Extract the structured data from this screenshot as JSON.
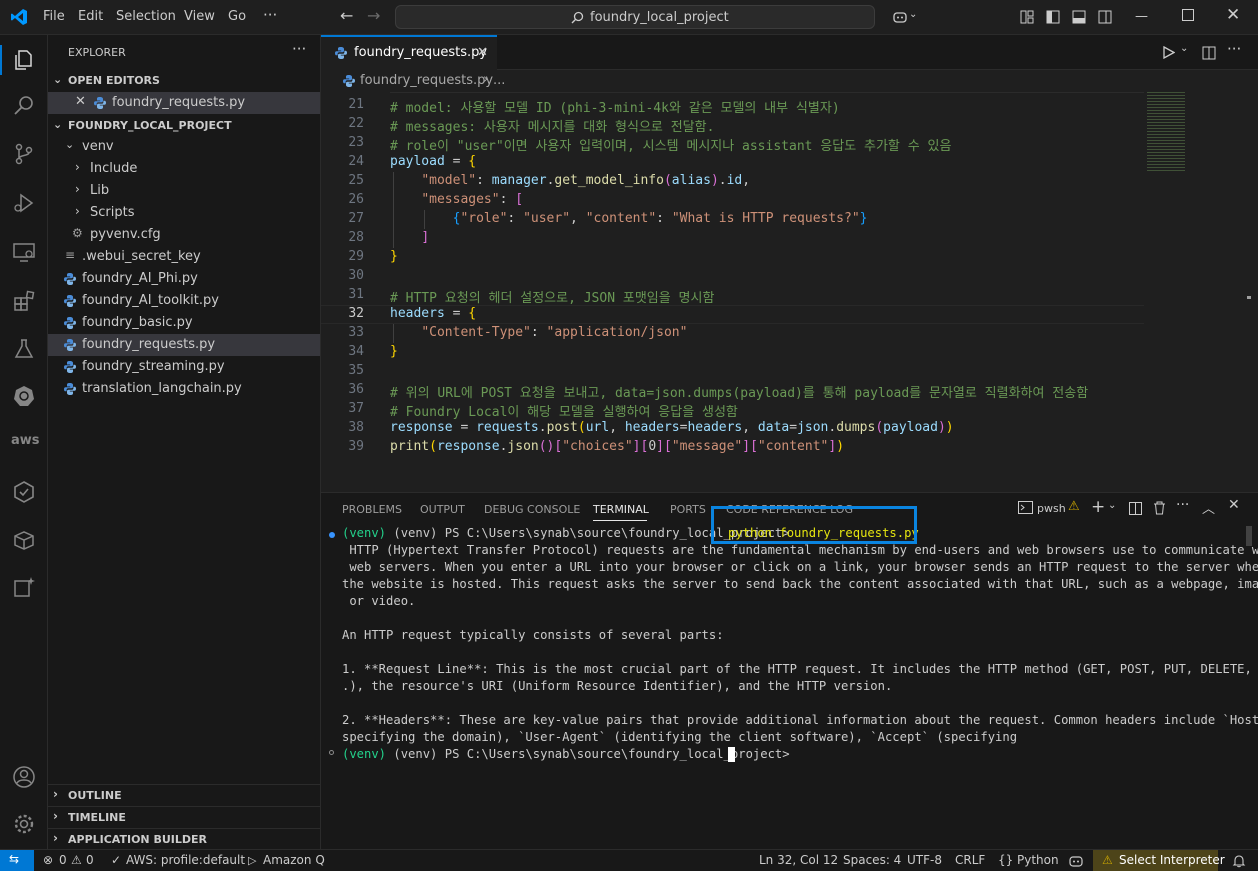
{
  "titlebar": {
    "menu": [
      "File",
      "Edit",
      "Selection",
      "View",
      "Go",
      "···"
    ],
    "search_text": "foundry_local_project"
  },
  "sidebar": {
    "title": "EXPLORER",
    "open_editors": {
      "label": "OPEN EDITORS",
      "items": [
        "foundry_requests.py"
      ]
    },
    "project": {
      "label": "FOUNDRY_LOCAL_PROJECT",
      "items": [
        "venv",
        "Include",
        "Lib",
        "Scripts",
        "pyvenv.cfg",
        ".webui_secret_key",
        "foundry_AI_Phi.py",
        "foundry_AI_toolkit.py",
        "foundry_basic.py",
        "foundry_requests.py",
        "foundry_streaming.py",
        "translation_langchain.py"
      ]
    },
    "bottom_sections": [
      "OUTLINE",
      "TIMELINE",
      "APPLICATION BUILDER"
    ]
  },
  "editor": {
    "tab_label": "foundry_requests.py",
    "breadcrumb_file": "foundry_requests.py",
    "breadcrumb_more": "...",
    "line_numbers": [
      "21",
      "22",
      "23",
      "24",
      "25",
      "26",
      "27",
      "28",
      "29",
      "30",
      "31",
      "32",
      "33",
      "34",
      "35",
      "36",
      "37",
      "38",
      "39"
    ],
    "current_line": "32",
    "lines": {
      "l21": "# model: 사용할 모델 ID (phi-3-mini-4k와 같은 모델의 내부 식별자)",
      "l22": "# messages: 사용자 메시지를 대화 형식으로 전달함.",
      "l23": "# role이 \"user\"이면 사용자 입력이며, 시스템 메시지나 assistant 응답도 추가할 수 있음",
      "l31": "# HTTP 요청의 헤더 설정으로, JSON 포맷임을 명시함",
      "l36": "# 위의 URL에 POST 요청을 보내고, data=json.dumps(payload)를 통해 payload를 문자열로 직렬화하여 전송함",
      "l37": "# Foundry Local이 해당 모델을 실행하여 응답을 생성함"
    }
  },
  "panel": {
    "tabs": [
      "PROBLEMS",
      "OUTPUT",
      "DEBUG CONSOLE",
      "TERMINAL",
      "PORTS",
      "CODE REFERENCE LOG"
    ],
    "active_tab": "TERMINAL",
    "shell_label": "pwsh",
    "prompt": "(venv) PS C:\\Users\\synab\\source\\foundry_local_project>",
    "command": "python foundry_requests.py",
    "output": [
      " HTTP (Hypertext Transfer Protocol) requests are the fundamental mechanism by end-users and web browsers use to communicate with",
      " web servers. When you enter a URL into your browser or click on a link, your browser sends an HTTP request to the server where",
      "the website is hosted. This request asks the server to send back the content associated with that URL, such as a webpage, image,",
      " or video.",
      "",
      "An HTTP request typically consists of several parts:",
      "",
      "1. **Request Line**: This is the most crucial part of the HTTP request. It includes the HTTP method (GET, POST, PUT, DELETE, etc",
      ".), the resource's URI (Uniform Resource Identifier), and the HTTP version.",
      "",
      "2. **Headers**: These are key-value pairs that provide additional information about the request. Common headers include `Host` (",
      "specifying the domain), `User-Agent` (identifying the client software), `Accept` (specifying"
    ]
  },
  "statusbar": {
    "errors": "0",
    "warnings": "0",
    "aws": "AWS: profile:default",
    "amazonq": "Amazon Q",
    "position": "Ln 32, Col 12",
    "spaces": "Spaces: 4",
    "encoding": "UTF-8",
    "eol": "CRLF",
    "language": "Python",
    "interpreter": "Select Interpreter"
  },
  "colors": {
    "accent": "#0078d4",
    "highlight_box": "#0a84e0",
    "warning_bg": "#4d4419"
  }
}
